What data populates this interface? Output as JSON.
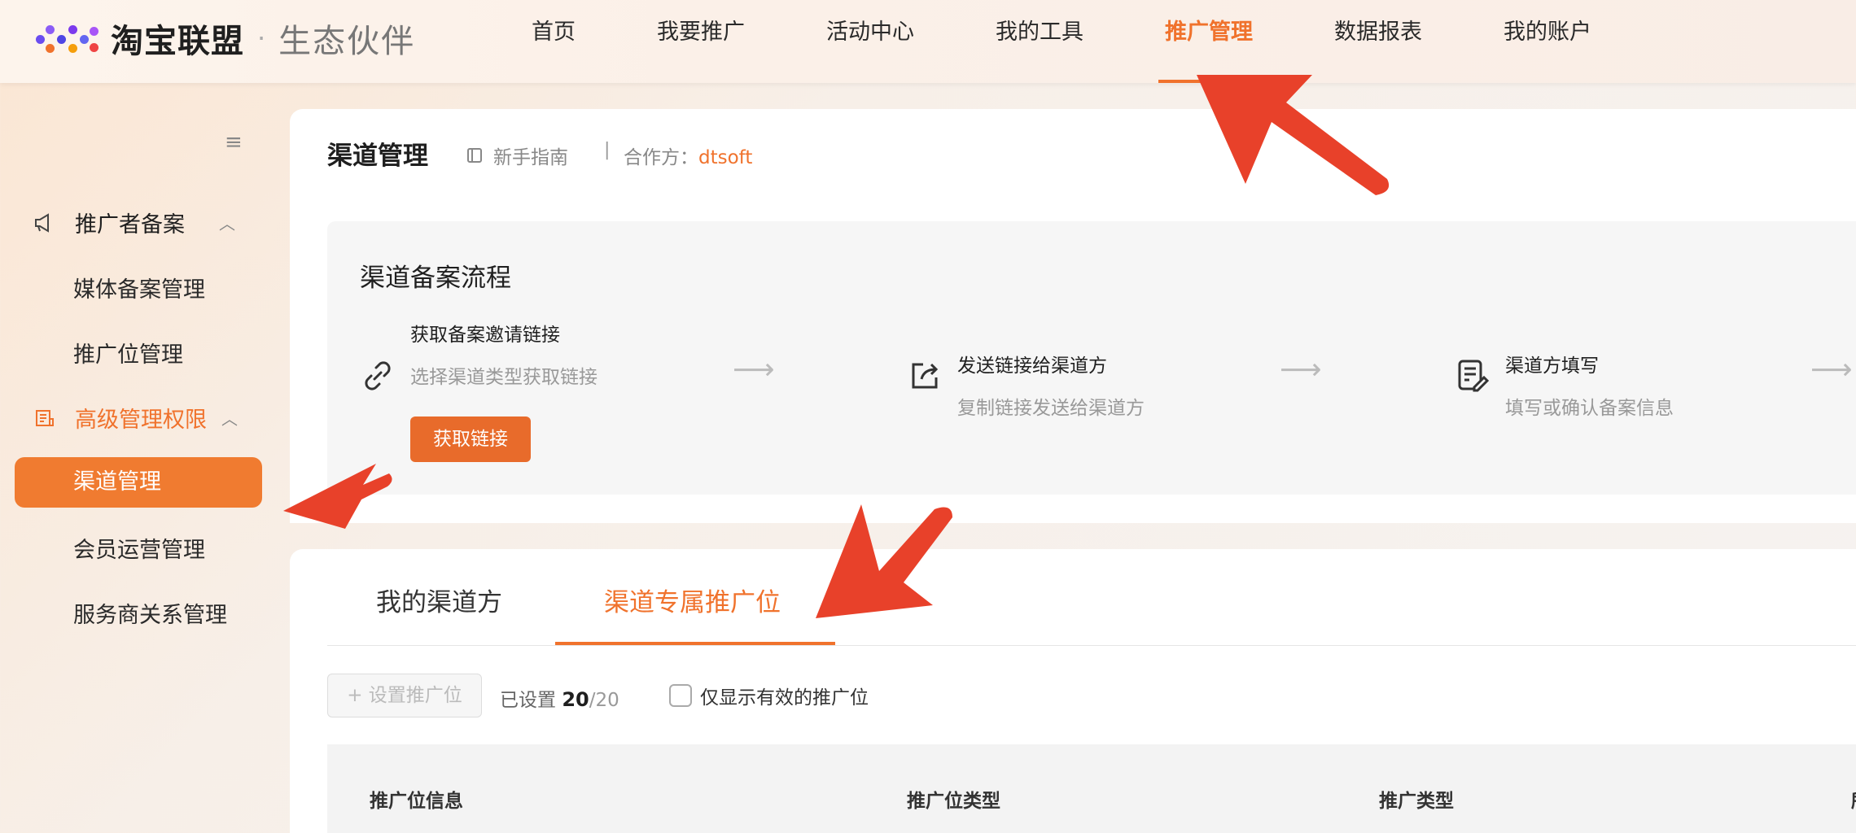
{
  "header": {
    "brand": "淘宝联盟",
    "separator": "·",
    "sub_brand": "生态伙伴",
    "nav": [
      "首页",
      "我要推广",
      "活动中心",
      "我的工具",
      "推广管理",
      "数据报表",
      "我的账户"
    ],
    "active_nav": "推广管理"
  },
  "sidebar": {
    "group1": {
      "label": "推广者备案",
      "items": [
        "媒体备案管理",
        "推广位管理"
      ]
    },
    "group2": {
      "label": "高级管理权限",
      "items": [
        "渠道管理",
        "会员运营管理",
        "服务商关系管理"
      ]
    },
    "active_item": "渠道管理"
  },
  "page": {
    "title": "渠道管理",
    "guide": "新手指南",
    "partner_label": "合作方：",
    "partner_value": "dtsoft"
  },
  "flow": {
    "title": "渠道备案流程",
    "steps": [
      {
        "title": "获取备案邀请链接",
        "desc": "选择渠道类型获取链接",
        "button": "获取链接"
      },
      {
        "title": "发送链接给渠道方",
        "desc": "复制链接发送给渠道方"
      },
      {
        "title": "渠道方填写",
        "desc": "填写或确认备案信息"
      }
    ]
  },
  "tabs": {
    "items": [
      "我的渠道方",
      "渠道专属推广位"
    ],
    "active": "渠道专属推广位"
  },
  "toolbar": {
    "set_button": "+ 设置推广位",
    "count_label": "已设置",
    "count_value": "20",
    "count_total": "/20",
    "checkbox_label": "仅显示有效的推广位"
  },
  "table": {
    "columns": [
      "推广位信息",
      "推广位类型",
      "推广类型",
      "所"
    ]
  },
  "colors": {
    "accent": "#f0722c",
    "annotation": "#e8412a"
  }
}
